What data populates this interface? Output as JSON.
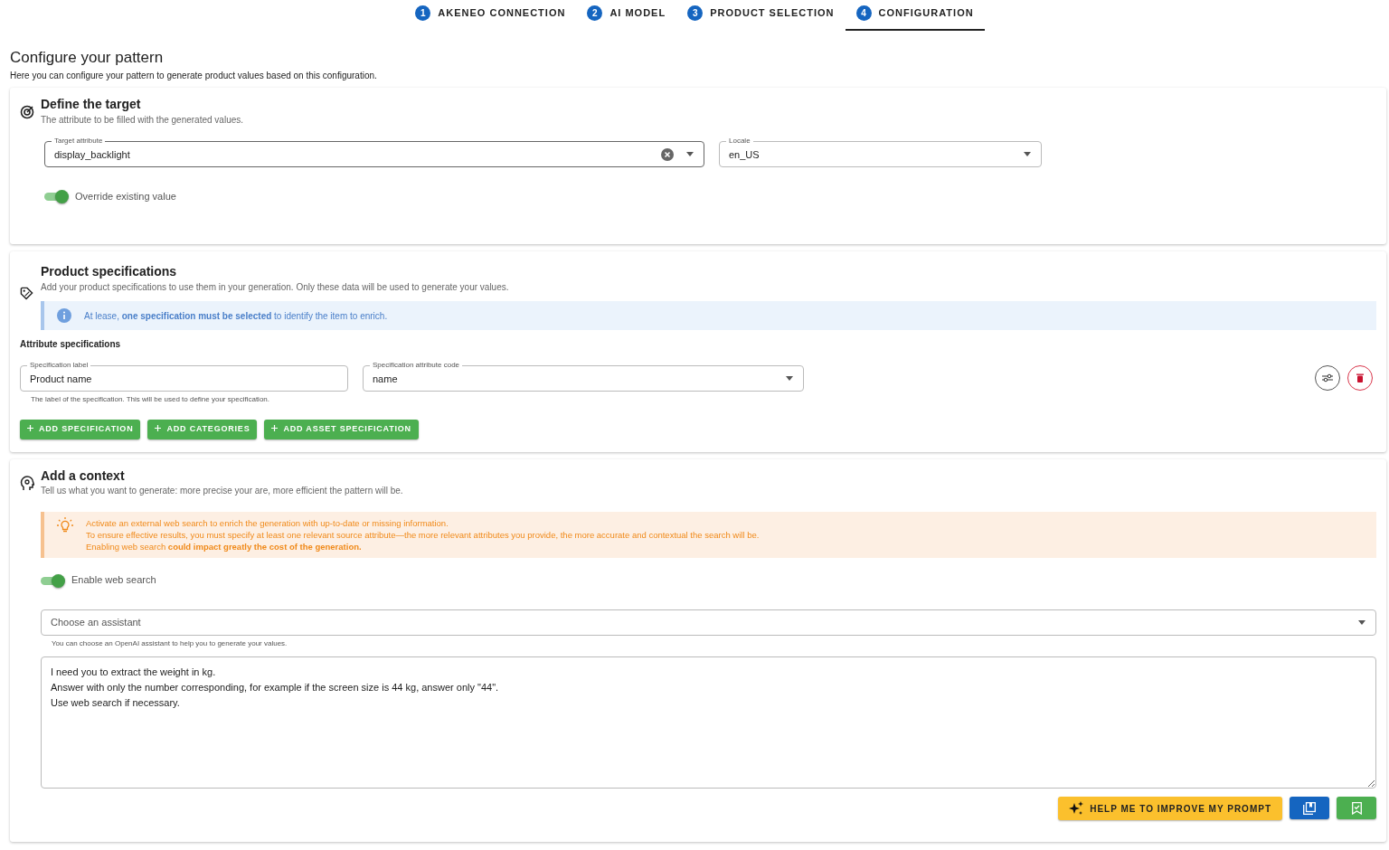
{
  "stepper": [
    {
      "number": "1",
      "label": "AKENEO CONNECTION",
      "selected": false
    },
    {
      "number": "2",
      "label": "AI MODEL",
      "selected": false
    },
    {
      "number": "3",
      "label": "PRODUCT SELECTION",
      "selected": false
    },
    {
      "number": "4",
      "label": "CONFIGURATION",
      "selected": true
    }
  ],
  "page": {
    "title": "Configure your pattern",
    "subtitle": "Here you can configure your pattern to generate product values based on this configuration."
  },
  "target": {
    "title": "Define the target",
    "description": "The attribute to be filled with the generated values.",
    "target_attribute": {
      "label": "Target attribute",
      "value": "display_backlight"
    },
    "locale": {
      "label": "Locale",
      "value": "en_US"
    },
    "override": {
      "label": "Override existing value",
      "on": true
    }
  },
  "specifications": {
    "title": "Product specifications",
    "description": "Add your product specifications to use them in your generation. Only these data will be used to generate your values.",
    "info": "At lease, **one specification must be selected** to identify the item to enrich.",
    "subheading": "Attribute specifications",
    "spec_label": {
      "label": "Specification label",
      "value": "Product name",
      "helper": "The label of the specification. This will be used to define your specification."
    },
    "spec_code": {
      "label": "Specification attribute code",
      "value": "name"
    },
    "buttons": [
      "ADD SPECIFICATION",
      "ADD CATEGORIES",
      "ADD ASSET SPECIFICATION"
    ]
  },
  "context": {
    "title": "Add a context",
    "description": "Tell us what you want to generate: more precise your are, more efficient the pattern will be.",
    "warning": [
      "Activate an external web search to enrich the generation with up-to-date or missing information.",
      "To ensure effective results, you must specify at least one relevant source attribute—the more relevant attributes you provide, the more accurate and contextual the search will be.",
      "Enabling web search **could impact greatly the cost of the generation.**"
    ],
    "web_search": {
      "label": "Enable web search",
      "on": true
    },
    "assistant": {
      "placeholder": "Choose an assistant",
      "helper": "You can choose an OpenAI assistant to help you to generate your values."
    },
    "prompt": "I need you to extract the weight in kg.\nAnswer with only the number corresponding, for example if the screen size is 44 kg, answer only \"44\".\nUse web search if necessary.",
    "improve_button": "HELP ME TO IMPROVE MY PROMPT"
  }
}
